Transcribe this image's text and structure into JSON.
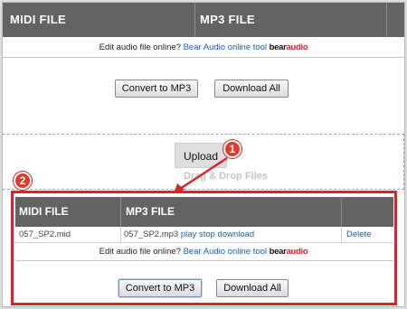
{
  "top_table": {
    "col_midi": "MIDI FILE",
    "col_mp3": "MP3 FILE",
    "promo_text": "Edit audio file online?",
    "promo_link": "Bear Audio online tool",
    "brand_a": "bear",
    "brand_b": "audio",
    "convert_label": "Convert to MP3",
    "download_all_label": "Download All"
  },
  "upload": {
    "button_label": "Upload",
    "drop_text": "Drag & Drop Files"
  },
  "markers": {
    "one": "1",
    "two": "2"
  },
  "bottom_table": {
    "col_midi": "MIDI FILE",
    "col_mp3": "MP3 FILE",
    "row": {
      "midi_name": "057_SP2.mid",
      "mp3_name": "057_SP2.mp3",
      "play": "play",
      "stop": "stop",
      "download": "download",
      "delete": "Delete"
    },
    "promo_text": "Edit audio file online?",
    "promo_link": "Bear Audio online tool",
    "brand_a": "bear",
    "brand_b": "audio",
    "convert_label": "Convert to MP3",
    "download_all_label": "Download All"
  },
  "colors": {
    "header_bg": "#636363",
    "link": "#1a5fb4",
    "highlight": "#d9232d"
  }
}
